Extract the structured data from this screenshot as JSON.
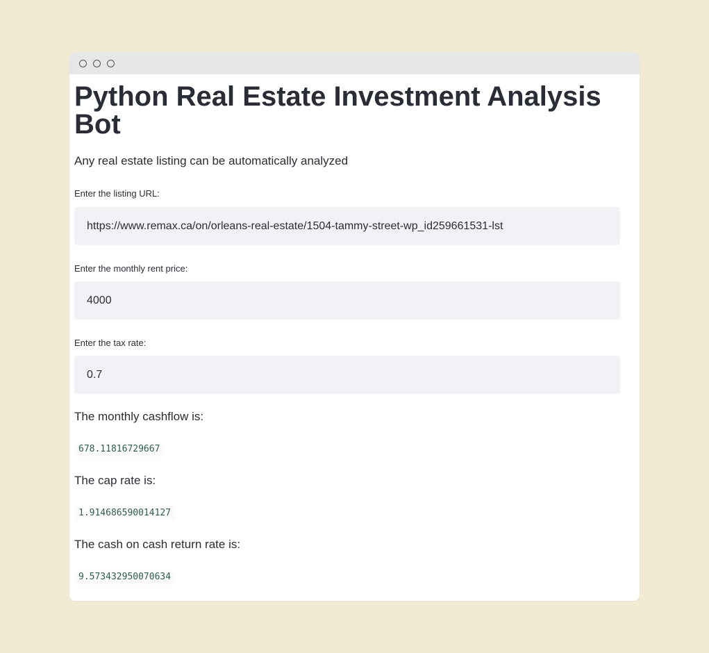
{
  "window": {
    "controls": [
      "circle-icon",
      "circle-icon",
      "circle-icon"
    ]
  },
  "page": {
    "title": "Python Real Estate Investment Analysis Bot",
    "subtitle": "Any real estate listing can be automatically analyzed"
  },
  "form": {
    "listing_url": {
      "label": "Enter the listing URL:",
      "value": "https://www.remax.ca/on/orleans-real-estate/1504-tammy-street-wp_id259661531-lst"
    },
    "monthly_rent": {
      "label": "Enter the monthly rent price:",
      "value": "4000"
    },
    "tax_rate": {
      "label": "Enter the tax rate:",
      "value": "0.7"
    }
  },
  "results": {
    "cashflow": {
      "label": "The monthly cashflow is:",
      "value": "678.11816729667"
    },
    "cap_rate": {
      "label": "The cap rate is:",
      "value": "1.914686590014127"
    },
    "cash_on_cash": {
      "label": "The cash on cash return rate is:",
      "value": "9.573432950070634"
    }
  },
  "colors": {
    "background": "#f0ebd2",
    "card": "#ffffff",
    "titlebar": "#e6e8e8",
    "input_bg": "#f0f2f6",
    "text": "#2b2d36",
    "code_text": "#2e5e4e"
  }
}
